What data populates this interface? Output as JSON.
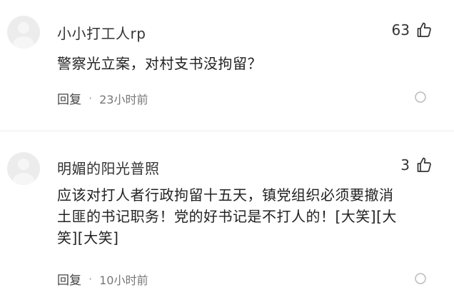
{
  "comments": [
    {
      "username": "小小打工人rp",
      "likes": "63",
      "text": "警察光立案，对村支书没拘留？",
      "reply_label": "回复",
      "separator": "·",
      "time": "23小时前",
      "icons": {
        "avatar": "default-avatar",
        "like": "thumbs-up-icon",
        "more": "open-circle-icon"
      }
    },
    {
      "username": "明媚的阳光普照",
      "likes": "3",
      "text_lines": [
        "应该对打人者行政拘留十五天，镇党组织必须要撤消",
        "土匪的书记职务！党的好书记是不打人的！[大笑][大",
        "笑][大笑]"
      ],
      "reply_label": "回复",
      "separator": "·",
      "time": "10小时前",
      "icons": {
        "avatar": "default-avatar",
        "like": "thumbs-up-icon",
        "more": "open-circle-icon"
      }
    }
  ]
}
